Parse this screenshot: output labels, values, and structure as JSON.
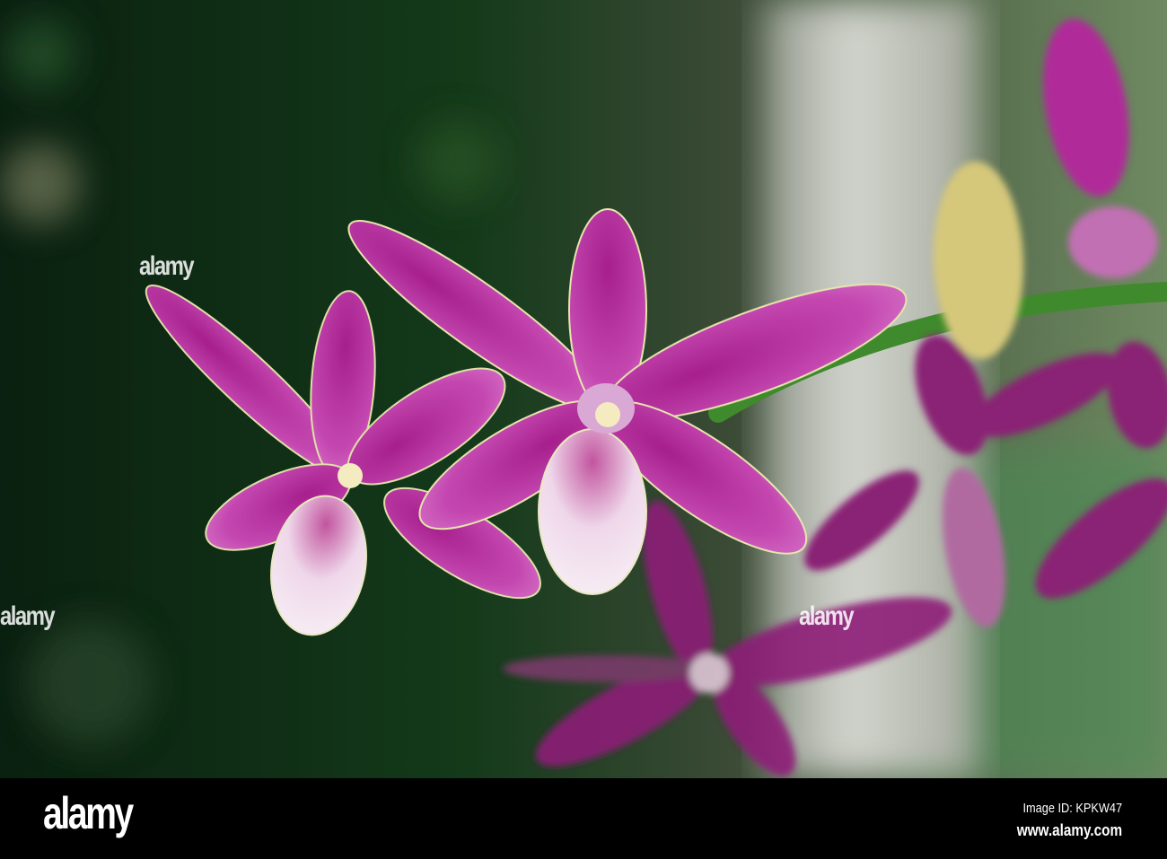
{
  "photo": {
    "subject": "purple orchid flowers",
    "colors": {
      "petal": "#b02a9a",
      "petal_light": "#d66cc4",
      "lip": "#f0dcef",
      "stem": "#3f8a2c",
      "background": "#0f2a14",
      "trunk": "#c9cbc4"
    }
  },
  "watermarks": [
    "alamy",
    "alamy",
    "alamy"
  ],
  "footer": {
    "logo": "alamy",
    "image_id": "Image ID: KPKW47",
    "website": "www.alamy.com"
  }
}
